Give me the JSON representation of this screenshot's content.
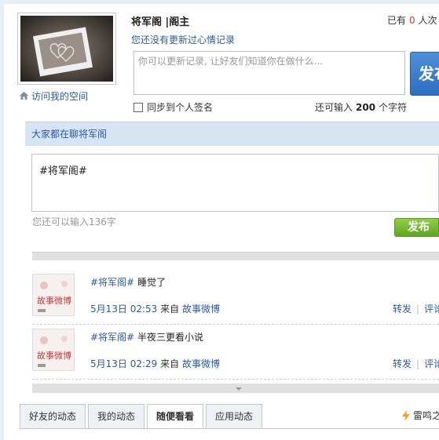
{
  "profile": {
    "username": "将军阁 |阁主",
    "visit_link": "访问我的空间",
    "has_count_prefix": "已有",
    "has_count_value": "0",
    "has_count_suffix": "人次",
    "no_update_text": "您还没有更新过心情记录"
  },
  "status": {
    "placeholder": "你可以更新记录, 让好友们知道你在做什么...",
    "publish_label": "发布",
    "sync_label": "同步到个人签名",
    "remain_prefix": "还可输入",
    "remain_value": "200",
    "remain_suffix": "个字符"
  },
  "chat": {
    "header": "大家都在聊将军阁",
    "input_value": "#将军阁#",
    "can_input": "您还可以输入136字",
    "publish_label": "发布"
  },
  "feed": {
    "items": [
      {
        "tag": "#将军阁#",
        "text": "睡觉了",
        "time": "5月13日 02:53",
        "from_label": "来自",
        "source": "故事微博",
        "repost": "转发",
        "comment": "评论",
        "thumb_text": "故事微博"
      },
      {
        "tag": "#将军阁#",
        "text": "半夜三更看小说",
        "time": "5月13日 02:29",
        "from_label": "来自",
        "source": "故事微博",
        "repost": "转发",
        "comment": "评论",
        "thumb_text": "故事微博"
      }
    ]
  },
  "tabs": [
    {
      "label": "好友的动态",
      "active": false
    },
    {
      "label": "我的动态",
      "active": false
    },
    {
      "label": "随便看看",
      "active": true
    },
    {
      "label": "应用动态",
      "active": false
    }
  ],
  "thunder": {
    "label": "雷鸣之"
  },
  "icons": {
    "home": "home-icon",
    "bolt": "lightning-icon",
    "checkbox": "checkbox-icon"
  },
  "colors": {
    "link_blue": "#2a5aa6",
    "publish_blue": "#2d6fbf",
    "publish_green": "#5ea621",
    "count_red": "#ee3333",
    "header_bg": "#d6e4f4"
  }
}
